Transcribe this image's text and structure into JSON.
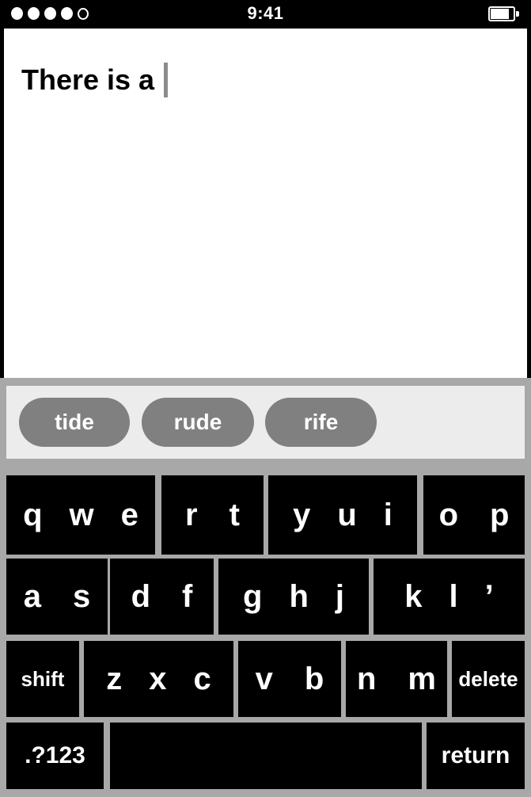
{
  "status_bar": {
    "time": "9:41",
    "signal_dots": {
      "filled": 4,
      "hollow": 1
    },
    "battery_icon": "battery-icon",
    "battery_level_percent": 70
  },
  "text_area": {
    "typed_text": "There is a ",
    "caret_visible": true
  },
  "suggestions": {
    "items": [
      {
        "label": "tide"
      },
      {
        "label": "rude"
      },
      {
        "label": "rife"
      }
    ]
  },
  "keyboard": {
    "rows": [
      {
        "groups": [
          {
            "name": "key-group-qwe",
            "keys": [
              "q",
              "w",
              "e"
            ],
            "type": "letters"
          },
          {
            "name": "key-group-rt",
            "keys": [
              "r",
              "t"
            ],
            "type": "letters"
          },
          {
            "name": "key-group-yui",
            "keys": [
              "y",
              "u",
              "i"
            ],
            "type": "letters"
          },
          {
            "name": "key-group-op",
            "keys": [
              "o",
              "p"
            ],
            "type": "letters"
          }
        ]
      },
      {
        "groups": [
          {
            "name": "key-group-as",
            "keys": [
              "a",
              "s"
            ],
            "type": "letters"
          },
          {
            "name": "key-group-df",
            "keys": [
              "d",
              "f"
            ],
            "type": "letters"
          },
          {
            "name": "key-group-ghj",
            "keys": [
              "g",
              "h",
              "j"
            ],
            "type": "letters"
          },
          {
            "name": "key-group-kl-apostrophe",
            "keys": [
              "k",
              "l",
              "’"
            ],
            "type": "letters"
          }
        ]
      },
      {
        "groups": [
          {
            "name": "key-shift",
            "label": "shift",
            "type": "label"
          },
          {
            "name": "key-group-zxc",
            "keys": [
              "z",
              "x",
              "c"
            ],
            "type": "letters"
          },
          {
            "name": "key-group-vb",
            "keys": [
              "v",
              "b"
            ],
            "type": "letters"
          },
          {
            "name": "key-group-nm",
            "keys": [
              "n",
              "m"
            ],
            "type": "letters"
          },
          {
            "name": "key-delete",
            "label": "delete",
            "type": "label"
          }
        ]
      },
      {
        "groups": [
          {
            "name": "key-numbers",
            "label": ".?123",
            "type": "label"
          },
          {
            "name": "key-space",
            "label": "",
            "type": "label"
          },
          {
            "name": "key-return",
            "label": "return",
            "type": "label"
          }
        ]
      }
    ]
  },
  "colors": {
    "status_bar_bg": "#000000",
    "text_area_bg": "#ffffff",
    "keyboard_bg": "#a8a8a8",
    "key_bg": "#000000",
    "key_text": "#ffffff",
    "suggestion_strip_bg": "#ececec",
    "suggestion_pill_bg": "#808080",
    "caret": "#8c8c8c"
  }
}
